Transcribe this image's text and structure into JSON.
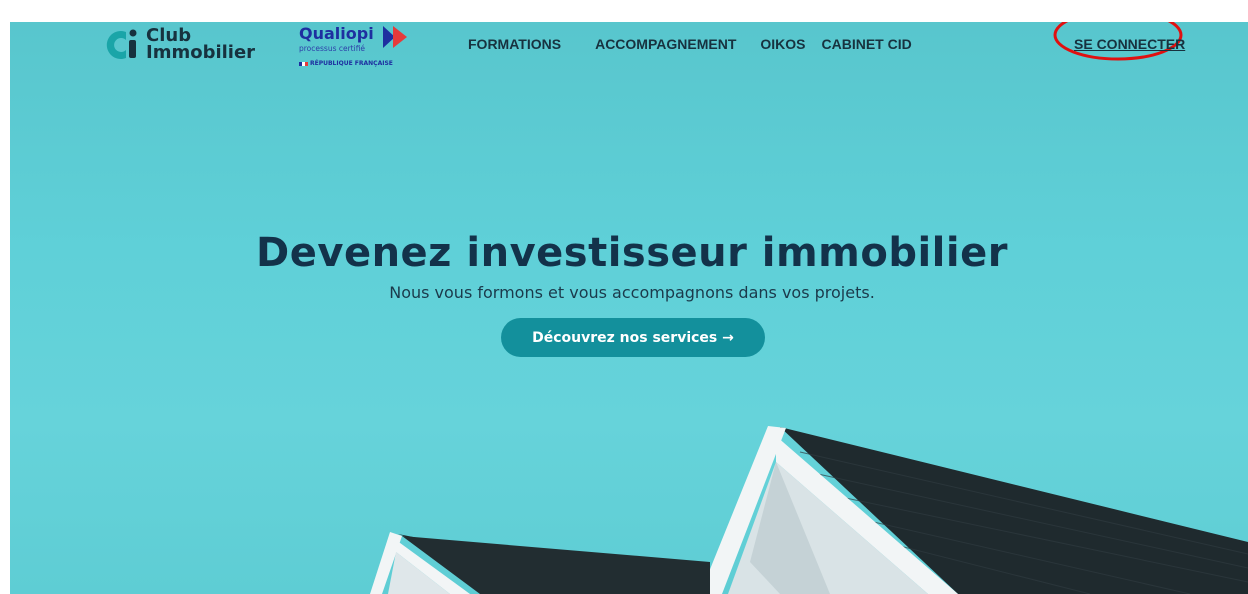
{
  "brand": {
    "logo_line1": "Club",
    "logo_line2": "Immobilier",
    "logo_colors": {
      "teal": "#1aa5a8",
      "dark": "#17323f"
    }
  },
  "certification": {
    "name": "Qualiopi",
    "subtitle": "processus certifié",
    "republic": "RÉPUBLIQUE FRANÇAISE",
    "colors": {
      "blue": "#1e2fa0",
      "red": "#e63a3a"
    }
  },
  "nav": {
    "items": [
      {
        "label": "FORMATIONS"
      },
      {
        "label": "ACCOMPAGNEMENT"
      },
      {
        "label": "OIKOS"
      },
      {
        "label": "CABINET CID"
      }
    ],
    "login_label": "SE CONNECTER"
  },
  "hero": {
    "title": "Devenez investisseur immobilier",
    "subtitle": "Nous vous formons et vous accompagnons dans vos projets.",
    "cta_label": "Découvrez nos services →",
    "background_color": "#5fcfd6",
    "cta_color": "#13909c"
  },
  "annotation": {
    "highlight_color": "#e01010",
    "highlight_shape": "ellipse",
    "highlight_target": "login-link"
  }
}
